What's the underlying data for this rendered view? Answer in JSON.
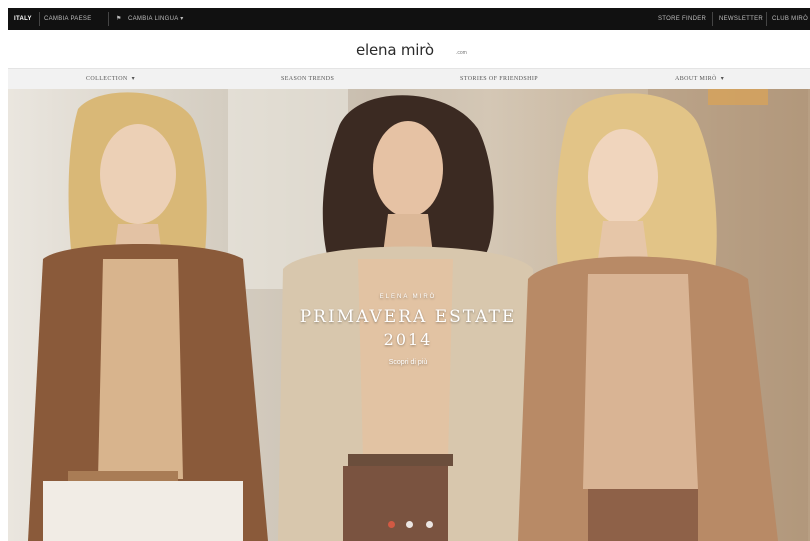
{
  "topbar": {
    "country": "ITALY",
    "change_country": "CAMBIA PAESE",
    "language_icon": "flag-icon",
    "change_language": "CAMBIA LINGUA",
    "store_finder": "STORE FINDER",
    "newsletter": "NEWSLETTER",
    "club": "CLUB MIRÒ"
  },
  "header": {
    "logo": "elena mirò",
    "logo_suffix": ".com"
  },
  "nav": {
    "items": [
      {
        "label": "COLLECTION",
        "has_dropdown": true
      },
      {
        "label": "SEASON TRENDS",
        "has_dropdown": false
      },
      {
        "label": "STORIES OF FRIENDSHIP",
        "has_dropdown": false
      },
      {
        "label": "ABOUT MIRÒ",
        "has_dropdown": true
      }
    ],
    "chevron": "▾"
  },
  "hero": {
    "brand": "ELENA MIRÒ",
    "title": "PRIMAVERA ESTATE",
    "year": "2014",
    "cta": "Scopri di più",
    "slides": 3,
    "active_slide": 1,
    "colors": {
      "jacket_brown": "#8a5a3a",
      "jacket_beige": "#d8c7ad",
      "jacket_tan": "#b88a66",
      "active_dot": "#e25a44"
    }
  }
}
